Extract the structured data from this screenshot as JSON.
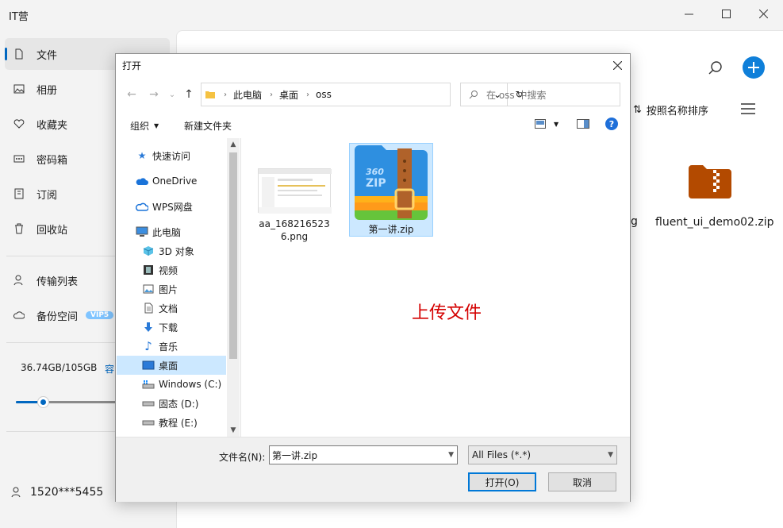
{
  "app": {
    "title": "IT营"
  },
  "sidebar": {
    "items": [
      {
        "label": "文件",
        "icon": "file-icon",
        "active": true
      },
      {
        "label": "相册",
        "icon": "album-icon"
      },
      {
        "label": "收藏夹",
        "icon": "heart-icon"
      },
      {
        "label": "密码箱",
        "icon": "safe-icon"
      },
      {
        "label": "订阅",
        "icon": "subscribe-icon"
      },
      {
        "label": "回收站",
        "icon": "trash-icon"
      },
      {
        "label": "传输列表",
        "icon": "transfer-icon"
      },
      {
        "label": "备份空间",
        "icon": "cloud-icon",
        "badge": "VIP5"
      }
    ],
    "storage": {
      "text": "36.74GB/105GB",
      "expand": "容",
      "used_fraction": 0.26
    },
    "user": {
      "phone": "1520***5455"
    }
  },
  "content": {
    "sort_label": "按照名称排序",
    "partial_label": "g",
    "right_file": {
      "name": "fluent_ui_demo02.zip",
      "icon": "zip-folder-icon"
    }
  },
  "dialog": {
    "title": "打开",
    "breadcrumb": [
      "此电脑",
      "桌面",
      "oss"
    ],
    "search_placeholder": "在 oss 中搜索",
    "toolbar": {
      "organize": "组织",
      "new_folder": "新建文件夹"
    },
    "tree": [
      {
        "label": "快速访问",
        "icon": "star-icon"
      },
      {
        "label": "OneDrive",
        "icon": "onedrive-icon"
      },
      {
        "label": "WPS网盘",
        "icon": "wps-cloud-icon"
      },
      {
        "label": "此电脑",
        "icon": "computer-icon"
      },
      {
        "label": "3D 对象",
        "icon": "cube-icon"
      },
      {
        "label": "视频",
        "icon": "video-icon"
      },
      {
        "label": "图片",
        "icon": "picture-icon"
      },
      {
        "label": "文档",
        "icon": "document-icon"
      },
      {
        "label": "下载",
        "icon": "download-icon"
      },
      {
        "label": "音乐",
        "icon": "music-icon"
      },
      {
        "label": "桌面",
        "icon": "desktop-icon",
        "selected": true
      },
      {
        "label": "Windows (C:)",
        "icon": "drive-c-icon"
      },
      {
        "label": "固态 (D:)",
        "icon": "drive-icon"
      },
      {
        "label": "教程 (E:)",
        "icon": "drive-icon"
      }
    ],
    "files": [
      {
        "name": "aa_1682165236.png",
        "icon": "png-thumbnail"
      },
      {
        "name": "第一讲.zip",
        "icon": "360zip-icon",
        "selected": true,
        "zip_brand": "360",
        "zip_text": "ZIP"
      }
    ],
    "upload_text": "上传文件",
    "filename_label": "文件名(N):",
    "filename_value": "第一讲.zip",
    "filetype": "All Files (*.*)",
    "open_button": "打开(O)",
    "cancel_button": "取消"
  }
}
